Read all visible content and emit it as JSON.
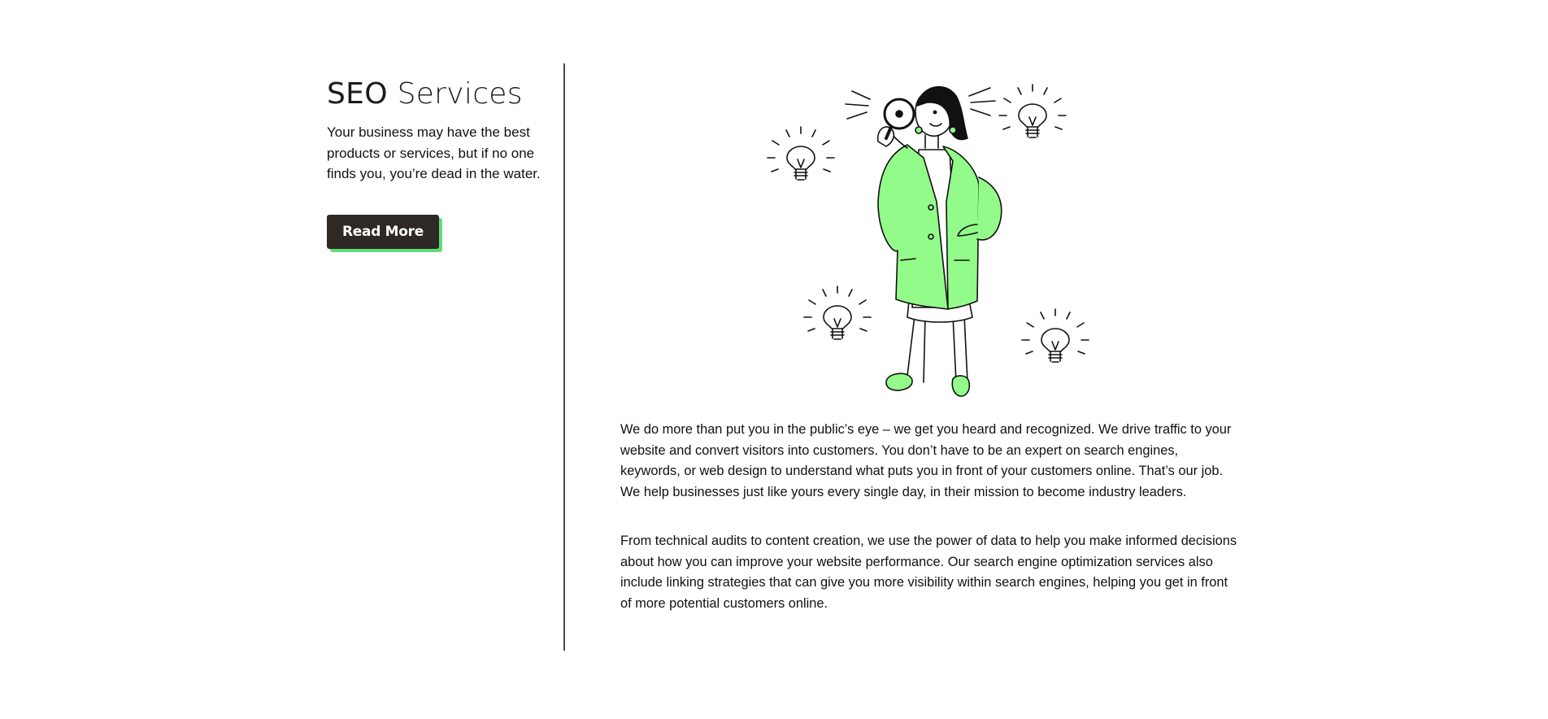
{
  "section": {
    "title_first": "SEO",
    "title_rest": " Services",
    "intro": "Your business may have the best products or services, but if no one finds you, you’re dead in the water.",
    "button_label": "Read More"
  },
  "body": {
    "paragraphs": [
      "We do more than put you in the public’s eye – we get you heard and recognized. We drive traffic to your website and convert visitors into customers. You don’t have to be an expert on search engines, keywords, or web design to understand what puts you in front of your customers online. That’s our job. We help businesses just like yours every single day, in their mission to become industry leaders.",
      "From technical audits to content creation, we use the power of data to help you make informed decisions about how you can improve your website performance. Our search engine optimization services also include linking strategies that can give you more visibility within search engines, helping you get in front of more potential customers online."
    ]
  },
  "illustration": {
    "subject": "woman-with-magnifying-glass",
    "icons": [
      "lightbulb-icon",
      "lightbulb-icon",
      "lightbulb-icon",
      "lightbulb-icon"
    ]
  },
  "colors": {
    "accent_green": "#5fdc77",
    "illustration_green": "#93fb8a",
    "button_bg": "#2f2925",
    "text": "#111111",
    "divider": "#4a4a4a"
  }
}
